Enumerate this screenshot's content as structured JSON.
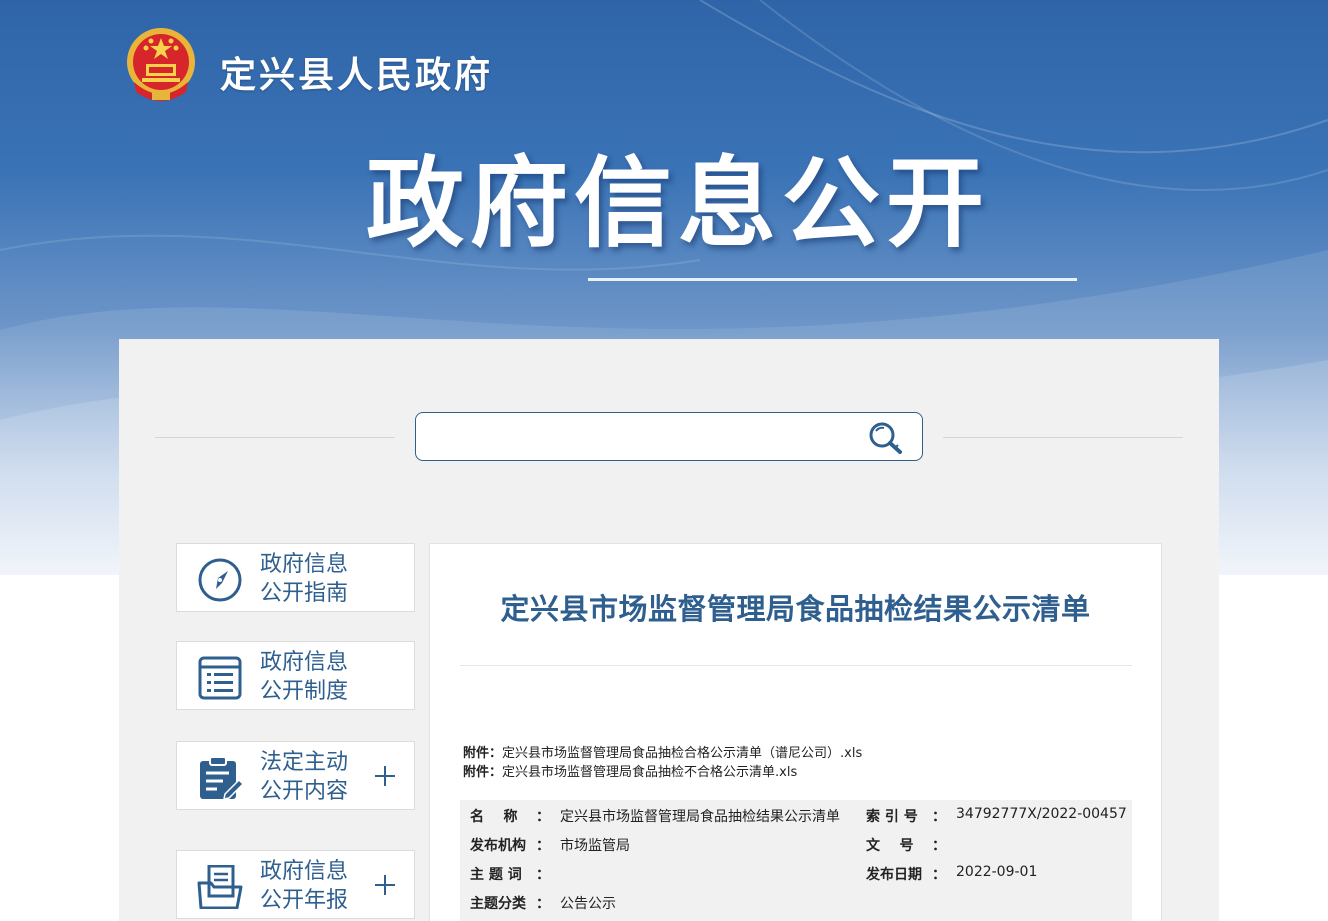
{
  "header": {
    "site_name": "定兴县人民政府",
    "hero_title": "政府信息公开"
  },
  "search": {
    "value": "",
    "placeholder": ""
  },
  "sidebar": {
    "items": [
      {
        "line1": "政府信息",
        "line2": "公开指南",
        "icon": "compass-icon",
        "expandable": false
      },
      {
        "line1": "政府信息",
        "line2": "公开制度",
        "icon": "list-icon",
        "expandable": false
      },
      {
        "line1": "法定主动",
        "line2": "公开内容",
        "icon": "clipboard-edit-icon",
        "expandable": true
      },
      {
        "line1": "政府信息",
        "line2": "公开年报",
        "icon": "folder-document-icon",
        "expandable": true
      }
    ]
  },
  "document": {
    "title": "定兴县市场监督管理局食品抽检结果公示清单",
    "attachments": [
      {
        "label": "附件：",
        "name": "定兴县市场监督管理局食品抽检合格公示清单（谱尼公司）.xls"
      },
      {
        "label": "附件：",
        "name": "定兴县市场监督管理局食品抽检不合格公示清单.xls"
      }
    ],
    "meta": {
      "name_label": "名    称",
      "name_value": "定兴县市场监督管理局食品抽检结果公示清单",
      "index_label": "索 引 号",
      "index_value": "34792777X/2022-00457",
      "org_label": "发布机构",
      "org_value": "市场监管局",
      "docno_label": "文    号",
      "docno_value": "",
      "subject_label": "主 题 词",
      "subject_value": "",
      "date_label": "发布日期",
      "date_value": "2022-09-01",
      "category_label": "主题分类",
      "category_value": "公告公示",
      "colon": "："
    }
  },
  "colors": {
    "primary": "#2f5f8f",
    "hero_top": "#2f65a8",
    "panel": "#f1f1f1"
  }
}
